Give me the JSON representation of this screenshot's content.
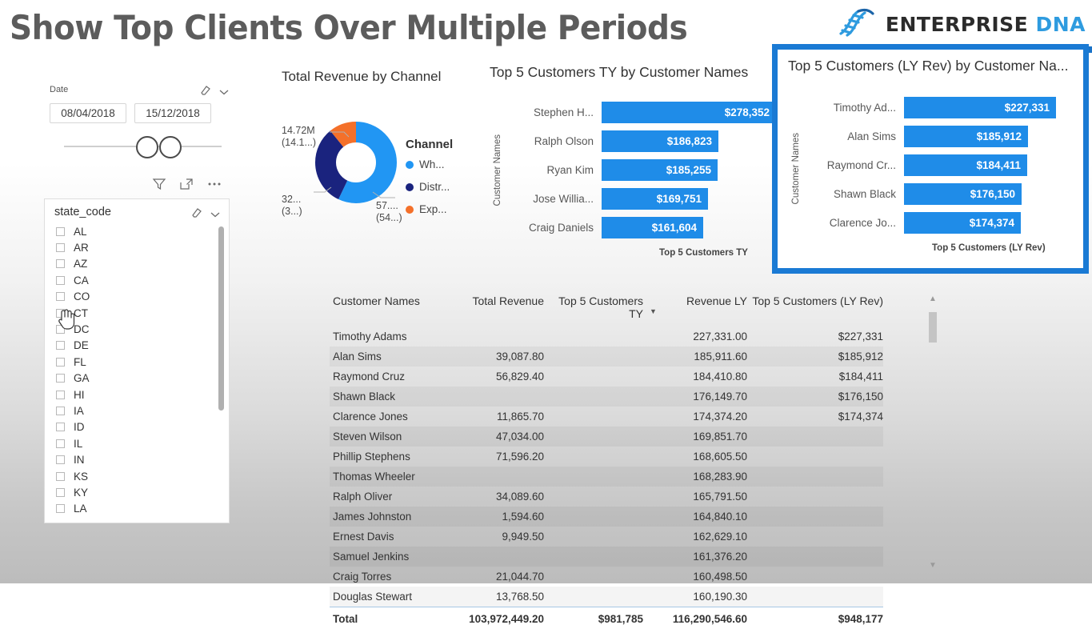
{
  "header": {
    "title": "Show Top Clients Over Multiple Periods",
    "logo_enterprise": "ENTERPRISE",
    "logo_dna": "DNA"
  },
  "date_slicer": {
    "title": "Date",
    "start_date": "08/04/2018",
    "end_date": "15/12/2018",
    "clear_icon": "eraser-icon",
    "expand_icon": "chevron-down-icon"
  },
  "state_slicer": {
    "title": "state_code",
    "clear_icon": "eraser-icon",
    "expand_icon": "chevron-down-icon",
    "tools": [
      "filter-icon",
      "focus-mode-icon",
      "more-options-icon"
    ],
    "items": [
      "AL",
      "AR",
      "AZ",
      "CA",
      "CO",
      "CT",
      "DC",
      "DE",
      "FL",
      "GA",
      "HI",
      "IA",
      "ID",
      "IL",
      "IN",
      "KS",
      "KY",
      "LA"
    ]
  },
  "donut": {
    "title": "Total Revenue by Channel",
    "legend_title": "Channel",
    "labels": [
      {
        "value": "14.72M",
        "pct": "(14.1...)"
      },
      {
        "value": "32...",
        "pct": "(3...)"
      },
      {
        "value": "57....",
        "pct": "(54...)"
      }
    ]
  },
  "ty_chart": {
    "title": "Top 5 Customers TY by Customer Names",
    "axis_title": "Customer Names",
    "x_label": "Top 5 Customers TY"
  },
  "ly_chart": {
    "title": "Top 5 Customers (LY Rev) by Customer Na...",
    "axis_title": "Customer Names",
    "x_label": "Top 5 Customers (LY Rev)"
  },
  "table": {
    "headers": [
      "Customer Names",
      "Total Revenue",
      "Top 5 Customers TY",
      "Revenue LY",
      "Top 5 Customers (LY Rev)"
    ],
    "sort_column": "Revenue LY",
    "sort_direction": "descending",
    "rows": [
      [
        "Timothy Adams",
        "",
        "",
        "227,331.00",
        "$227,331"
      ],
      [
        "Alan Sims",
        "39,087.80",
        "",
        "185,911.60",
        "$185,912"
      ],
      [
        "Raymond Cruz",
        "56,829.40",
        "",
        "184,410.80",
        "$184,411"
      ],
      [
        "Shawn Black",
        "",
        "",
        "176,149.70",
        "$176,150"
      ],
      [
        "Clarence Jones",
        "11,865.70",
        "",
        "174,374.20",
        "$174,374"
      ],
      [
        "Steven Wilson",
        "47,034.00",
        "",
        "169,851.70",
        ""
      ],
      [
        "Phillip Stephens",
        "71,596.20",
        "",
        "168,605.50",
        ""
      ],
      [
        "Thomas Wheeler",
        "",
        "",
        "168,283.90",
        ""
      ],
      [
        "Ralph Oliver",
        "34,089.60",
        "",
        "165,791.50",
        ""
      ],
      [
        "James Johnston",
        "1,594.60",
        "",
        "164,840.10",
        ""
      ],
      [
        "Ernest Davis",
        "9,949.50",
        "",
        "162,629.10",
        ""
      ],
      [
        "Samuel Jenkins",
        "",
        "",
        "161,376.20",
        ""
      ],
      [
        "Craig Torres",
        "21,044.70",
        "",
        "160,498.50",
        ""
      ],
      [
        "Douglas Stewart",
        "13,768.50",
        "",
        "160,190.30",
        ""
      ]
    ],
    "total_row": [
      "Total",
      "103,972,449.20",
      "$981,785",
      "116,290,546.60",
      "$948,177"
    ]
  },
  "chart_data": [
    {
      "type": "pie",
      "title": "Total Revenue by Channel",
      "legend_title": "Channel",
      "legend_position": "right",
      "categories": [
        "Wh...",
        "Distr...",
        "Exp..."
      ],
      "values": [
        57.0,
        32.0,
        14.72
      ],
      "colors": [
        "#2196f3",
        "#1a237e",
        "#f4702a"
      ],
      "data_labels": [
        "57.... (54...)",
        "32... (3...)",
        "14.72M (14.1...)"
      ]
    },
    {
      "type": "bar",
      "orientation": "horizontal",
      "title": "Top 5 Customers TY by Customer Names",
      "xlabel": "Top 5 Customers TY",
      "ylabel": "Customer Names",
      "categories": [
        "Stephen H...",
        "Ralph Olson",
        "Ryan Kim",
        "Jose Willia...",
        "Craig Daniels"
      ],
      "values": [
        278352,
        186823,
        185255,
        169751,
        161604
      ],
      "data_labels": [
        "$278,352",
        "$186,823",
        "$185,255",
        "$169,751",
        "$161,604"
      ],
      "bar_color": "#1f8ce8",
      "xlim": [
        0,
        278352
      ]
    },
    {
      "type": "bar",
      "orientation": "horizontal",
      "title": "Top 5 Customers (LY Rev) by Customer Na...",
      "xlabel": "Top 5 Customers (LY Rev)",
      "ylabel": "Customer Names",
      "categories": [
        "Timothy Ad...",
        "Alan Sims",
        "Raymond Cr...",
        "Shawn Black",
        "Clarence Jo..."
      ],
      "values": [
        227331,
        185912,
        184411,
        176150,
        174374
      ],
      "data_labels": [
        "$227,331",
        "$185,912",
        "$184,411",
        "$176,150",
        "$174,374"
      ],
      "bar_color": "#1f8ce8",
      "xlim": [
        0,
        227331
      ],
      "highlighted": true
    }
  ],
  "colors": {
    "accent_blue": "#1f8ce8",
    "highlight_border": "#1a7ad4",
    "legend_wholesale": "#2196f3",
    "legend_distributor": "#1a237e",
    "legend_export": "#f4702a",
    "title_gray": "#5c5c5c"
  }
}
